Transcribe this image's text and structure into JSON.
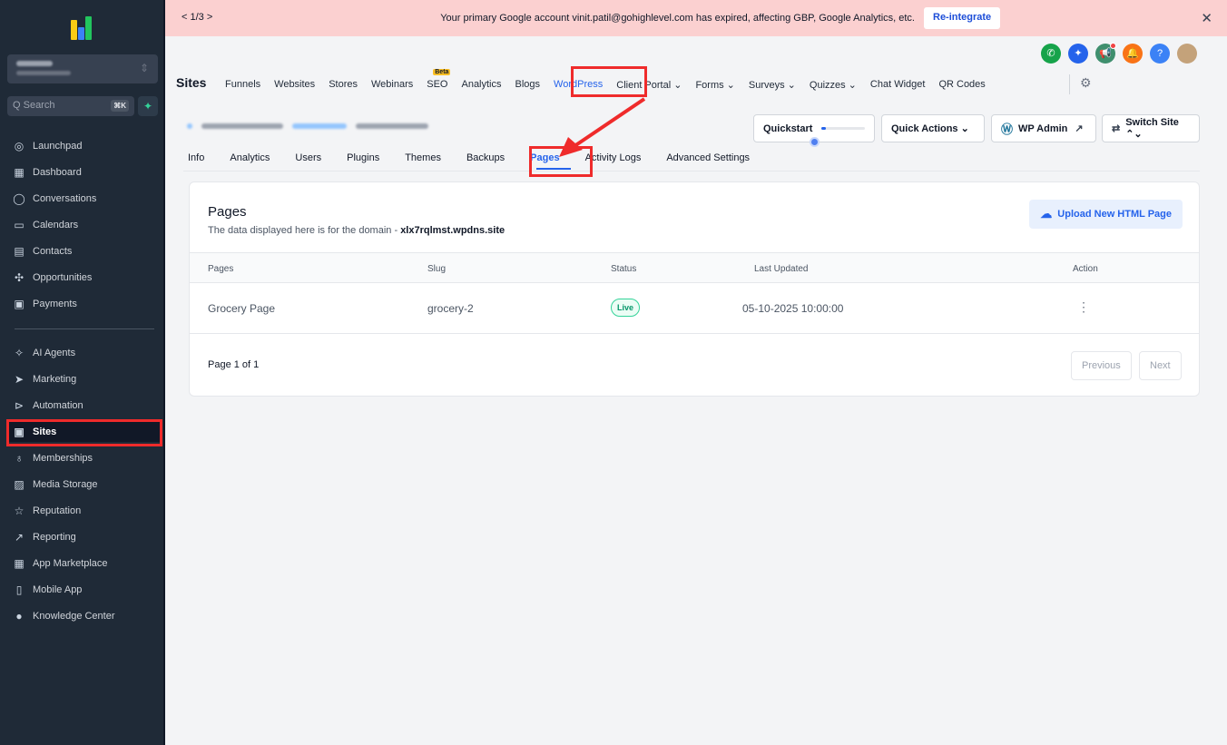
{
  "banner": {
    "pager": "< 1/3 >",
    "message": "Your primary Google account vinit.patil@gohighlevel.com has expired, affecting GBP, Google Analytics, etc.",
    "reintegrate": "Re-integrate",
    "close": "✕"
  },
  "sidebar": {
    "search_placeholder": "Q Search",
    "search_kbd": "⌘K",
    "items_top": [
      {
        "icon": "launchpad-icon",
        "glyph": "◎",
        "label": "Launchpad"
      },
      {
        "icon": "dashboard-icon",
        "glyph": "▦",
        "label": "Dashboard"
      },
      {
        "icon": "conversations-icon",
        "glyph": "◯",
        "label": "Conversations"
      },
      {
        "icon": "calendar-icon",
        "glyph": "▭",
        "label": "Calendars"
      },
      {
        "icon": "contacts-icon",
        "glyph": "▤",
        "label": "Contacts"
      },
      {
        "icon": "opportunities-icon",
        "glyph": "✣",
        "label": "Opportunities"
      },
      {
        "icon": "payments-icon",
        "glyph": "▣",
        "label": "Payments"
      }
    ],
    "items_bottom": [
      {
        "icon": "ai-agents-icon",
        "glyph": "✧",
        "label": "AI Agents"
      },
      {
        "icon": "marketing-icon",
        "glyph": "➤",
        "label": "Marketing"
      },
      {
        "icon": "automation-icon",
        "glyph": "⊳",
        "label": "Automation"
      },
      {
        "icon": "sites-icon",
        "glyph": "▣",
        "label": "Sites"
      },
      {
        "icon": "memberships-icon",
        "glyph": "♁",
        "label": "Memberships"
      },
      {
        "icon": "media-storage-icon",
        "glyph": "▨",
        "label": "Media Storage"
      },
      {
        "icon": "reputation-icon",
        "glyph": "☆",
        "label": "Reputation"
      },
      {
        "icon": "reporting-icon",
        "glyph": "↗",
        "label": "Reporting"
      },
      {
        "icon": "app-marketplace-icon",
        "glyph": "▦",
        "label": "App Marketplace"
      },
      {
        "icon": "mobile-app-icon",
        "glyph": "▯",
        "label": "Mobile App"
      },
      {
        "icon": "knowledge-center-icon",
        "glyph": "●",
        "label": "Knowledge Center"
      }
    ],
    "active_item": "Sites"
  },
  "header": {
    "title": "Sites",
    "tabs": [
      "Funnels",
      "Websites",
      "Stores",
      "Webinars",
      "SEO",
      "Analytics",
      "Blogs",
      "WordPress",
      "Client Portal ⌄",
      "Forms ⌄",
      "Surveys ⌄",
      "Quizzes ⌄",
      "Chat Widget",
      "QR Codes"
    ],
    "seo_badge": "Beta",
    "active_tab": "WordPress"
  },
  "site_actions": {
    "quickstart": "Quickstart",
    "quickstart_progress": 0.1,
    "quick_actions": "Quick Actions ⌄",
    "wp_admin": "WP Admin",
    "switch_site": "Switch Site ⌃⌄"
  },
  "subtabs": {
    "items": [
      "Info",
      "Analytics",
      "Users",
      "Plugins",
      "Themes",
      "Backups",
      "Pages",
      "Activity Logs",
      "Advanced Settings"
    ],
    "active": "Pages"
  },
  "pages_card": {
    "title": "Pages",
    "subtitle_prefix": "The data displayed here is for the domain - ",
    "domain": "xlx7rqlmst.wpdns.site",
    "upload_button": "Upload New HTML Page",
    "columns": [
      "Pages",
      "Slug",
      "Status",
      "Last Updated",
      "Action"
    ],
    "rows": [
      {
        "page": "Grocery Page",
        "slug": "grocery-2",
        "status": "Live",
        "last_updated": "05-10-2025 10:00:00",
        "action": "⋮"
      }
    ],
    "pagination": {
      "label": "Page 1 of 1",
      "previous": "Previous",
      "next": "Next"
    }
  },
  "colors": {
    "sidebar_bg": "#1f2a37",
    "accent": "#2563eb",
    "annotation_red": "#ef2b2b",
    "banner_bg": "#fbd0d0"
  }
}
